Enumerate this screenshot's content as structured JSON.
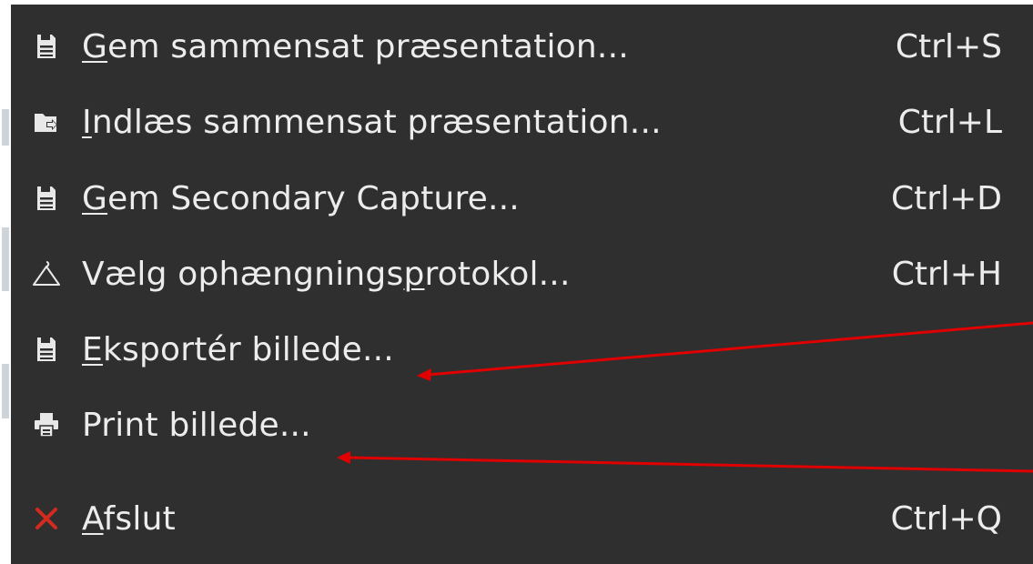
{
  "menu": {
    "items": [
      {
        "pre": "",
        "u": "G",
        "post": "em sammensat præsentation...",
        "shortcut": "Ctrl+S",
        "icon": "document-save-icon"
      },
      {
        "pre": "",
        "u": "I",
        "post": "ndlæs sammensat præsentation...",
        "shortcut": "Ctrl+L",
        "icon": "folder-open-icon"
      },
      {
        "pre": "",
        "u": "G",
        "post": "em Secondary Capture...",
        "shortcut": "Ctrl+D",
        "icon": "document-save-icon"
      },
      {
        "pre": "Vælg ophængnings",
        "u": "p",
        "post": "rotokol...",
        "shortcut": "Ctrl+H",
        "icon": "hanger-icon"
      },
      {
        "pre": "",
        "u": "E",
        "post": "ksportér billede...",
        "shortcut": "",
        "icon": "document-save-icon"
      },
      {
        "pre": "Print billede...",
        "u": "",
        "post": "",
        "shortcut": "",
        "icon": "printer-icon"
      },
      {
        "pre": "",
        "u": "A",
        "post": "fslut",
        "shortcut": "Ctrl+Q",
        "icon": "close-red-x-icon"
      }
    ]
  },
  "annotations": {
    "arrow_color": "#e00000"
  }
}
